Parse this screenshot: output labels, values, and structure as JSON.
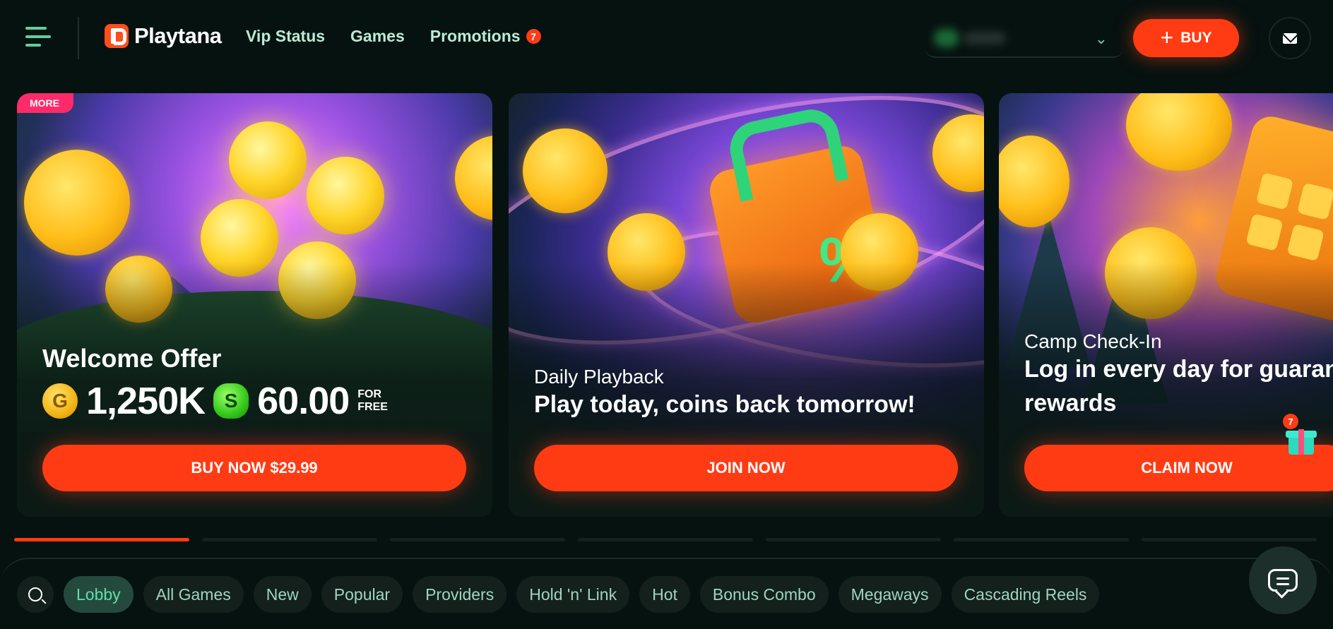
{
  "header": {
    "logo_text": "Playtana",
    "nav": [
      {
        "label": "Vip Status"
      },
      {
        "label": "Games"
      },
      {
        "label": "Promotions",
        "badge": "7"
      }
    ],
    "buy_label": "BUY",
    "balance_icon": "chevron-down-icon",
    "mail_icon": "envelope-icon"
  },
  "banners": [
    {
      "tag": "MORE",
      "title": "Welcome Offer",
      "gold_coins": "1,250K",
      "sweep_coins": "60.00",
      "for_free_line1": "FOR",
      "for_free_line2": "FREE",
      "cta": "BUY NOW $29.99"
    },
    {
      "subtitle": "Daily Playback",
      "title": "Play today, coins back tomorrow!",
      "cta": "JOIN NOW"
    },
    {
      "subtitle": "Camp Check-In",
      "title": "Log in every day for guaranteed rewards",
      "cta": "CLAIM NOW",
      "gift_badge": "7"
    }
  ],
  "coins": {
    "gold_symbol": "G",
    "sweep_symbol": "S"
  },
  "categories": [
    {
      "label": "Lobby",
      "active": true
    },
    {
      "label": "All Games"
    },
    {
      "label": "New"
    },
    {
      "label": "Popular"
    },
    {
      "label": "Providers"
    },
    {
      "label": "Hold 'n' Link"
    },
    {
      "label": "Hot"
    },
    {
      "label": "Bonus Combo"
    },
    {
      "label": "Megaways"
    },
    {
      "label": "Cascading Reels"
    }
  ],
  "colors": {
    "background": "#061210",
    "accent": "#ff3b14",
    "nav_text": "#b9ecd4",
    "chip_active": "#244a3e"
  },
  "icons": [
    "hamburger-menu-icon",
    "playtana-logo-icon",
    "plus-icon",
    "envelope-icon",
    "search-icon",
    "chat-icon",
    "gift-icon"
  ]
}
